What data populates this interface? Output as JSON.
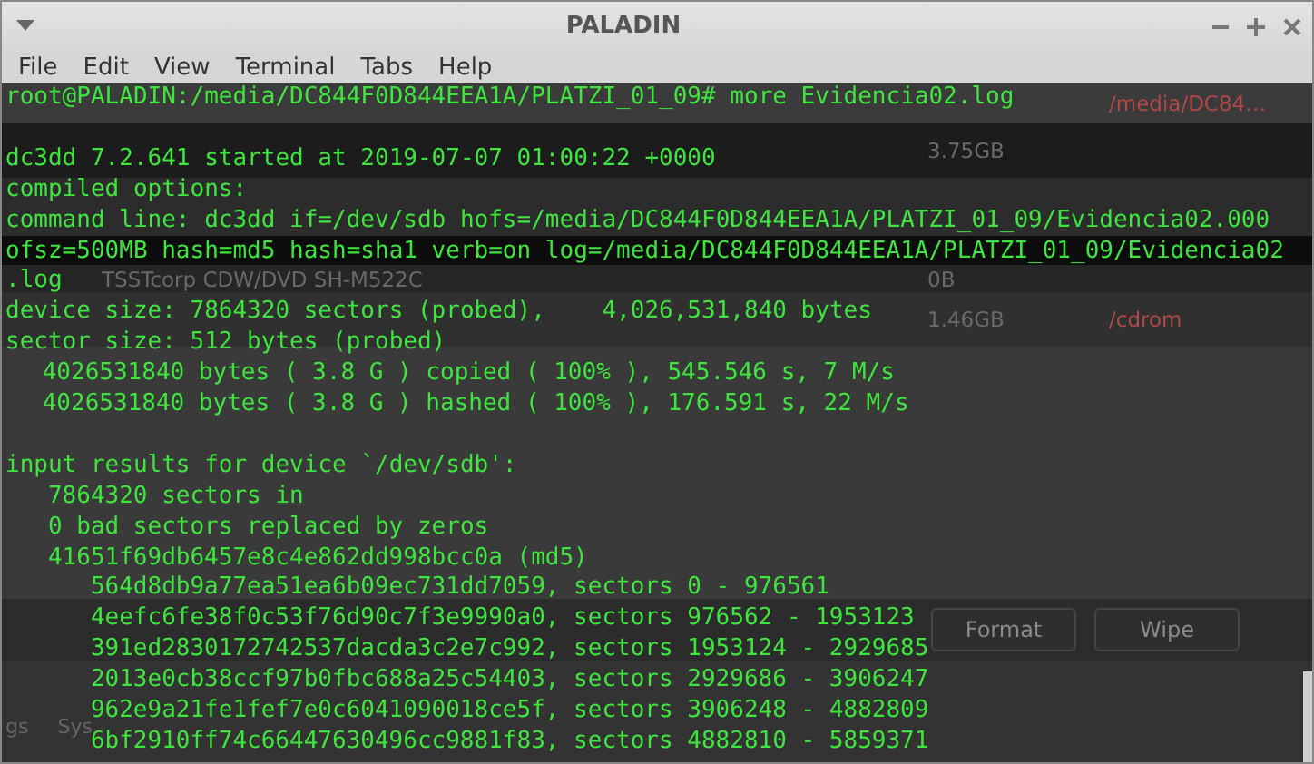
{
  "window": {
    "title": "PALADIN"
  },
  "menu": [
    "File",
    "Edit",
    "View",
    "Terminal",
    "Tabs",
    "Help"
  ],
  "background_app": {
    "rows": [
      {
        "column_5": "/media/DC84…"
      },
      {
        "column_4": "3.75GB"
      },
      {},
      {},
      {
        "column_1": "TSSTcorp CDW/DVD SH-M522C",
        "column_4": "0B"
      },
      {
        "column_4": "1.46GB",
        "column_5": "/cdrom"
      }
    ],
    "buttons": [
      "Format",
      "Wipe"
    ],
    "tabs": [
      "gs",
      "Sys"
    ]
  },
  "terminal": {
    "blocks": [
      [
        {
          "text": "root@PALADIN:/media/DC844F0D844EEA1A/PLATZI_01_09# more Evidencia02.log"
        }
      ],
      [
        {
          "text": "dc3dd 7.2.641 started at 2019-07-07 01:00:22 +0000"
        },
        {
          "text": "compiled options:"
        },
        {
          "text": "command line: dc3dd if=/dev/sdb hofs=/media/DC844F0D844EEA1A/PLATZI_01_09/Evidencia02.000"
        },
        {
          "text": "ofsz=500MB hash=md5 hash=sha1 verb=on log=/media/DC844F0D844EEA1A/PLATZI_01_09/Evidencia02"
        },
        {
          "text": ".log"
        },
        {
          "text": "device size: 7864320 sectors (probed),    4,026,531,840 bytes"
        },
        {
          "text": "sector size: 512 bytes (probed)",
          "children": [
            {
              "text": "4026531840 bytes ( 3.8 G ) copied ( 100% ), 545.546 s, 7 M/s"
            },
            {
              "text": "4026531840 bytes ( 3.8 G ) hashed ( 100% ), 176.591 s, 22 M/s"
            }
          ]
        }
      ],
      [
        {
          "text": "input results for device `/dev/sdb':",
          "children": [
            {
              "text": "7864320 sectors in"
            },
            {
              "text": "0 bad sectors replaced by zeros"
            },
            {
              "text": "41651f69db6457e8c4e862dd998bcc0a (md5)",
              "children": [
                {
                  "text": "564d8db9a77ea51ea6b09ec731dd7059, sectors 0 - 976561"
                },
                {
                  "text": "4eefc6fe38f0c53f76d90c7f3e9990a0, sectors 976562 - 1953123"
                },
                {
                  "text": "391ed2830172742537dacda3c2e7c992, sectors 1953124 - 2929685"
                },
                {
                  "text": "2013e0cb38ccf97b0fbc688a25c54403, sectors 2929686 - 3906247"
                },
                {
                  "text": "962e9a21fe1fef7e0c6041090018ce5f, sectors 3906248 - 4882809"
                },
                {
                  "text": "6bf2910ff74c66447630496cc9881f83, sectors 4882810 - 5859371"
                }
              ]
            }
          ]
        }
      ]
    ]
  }
}
